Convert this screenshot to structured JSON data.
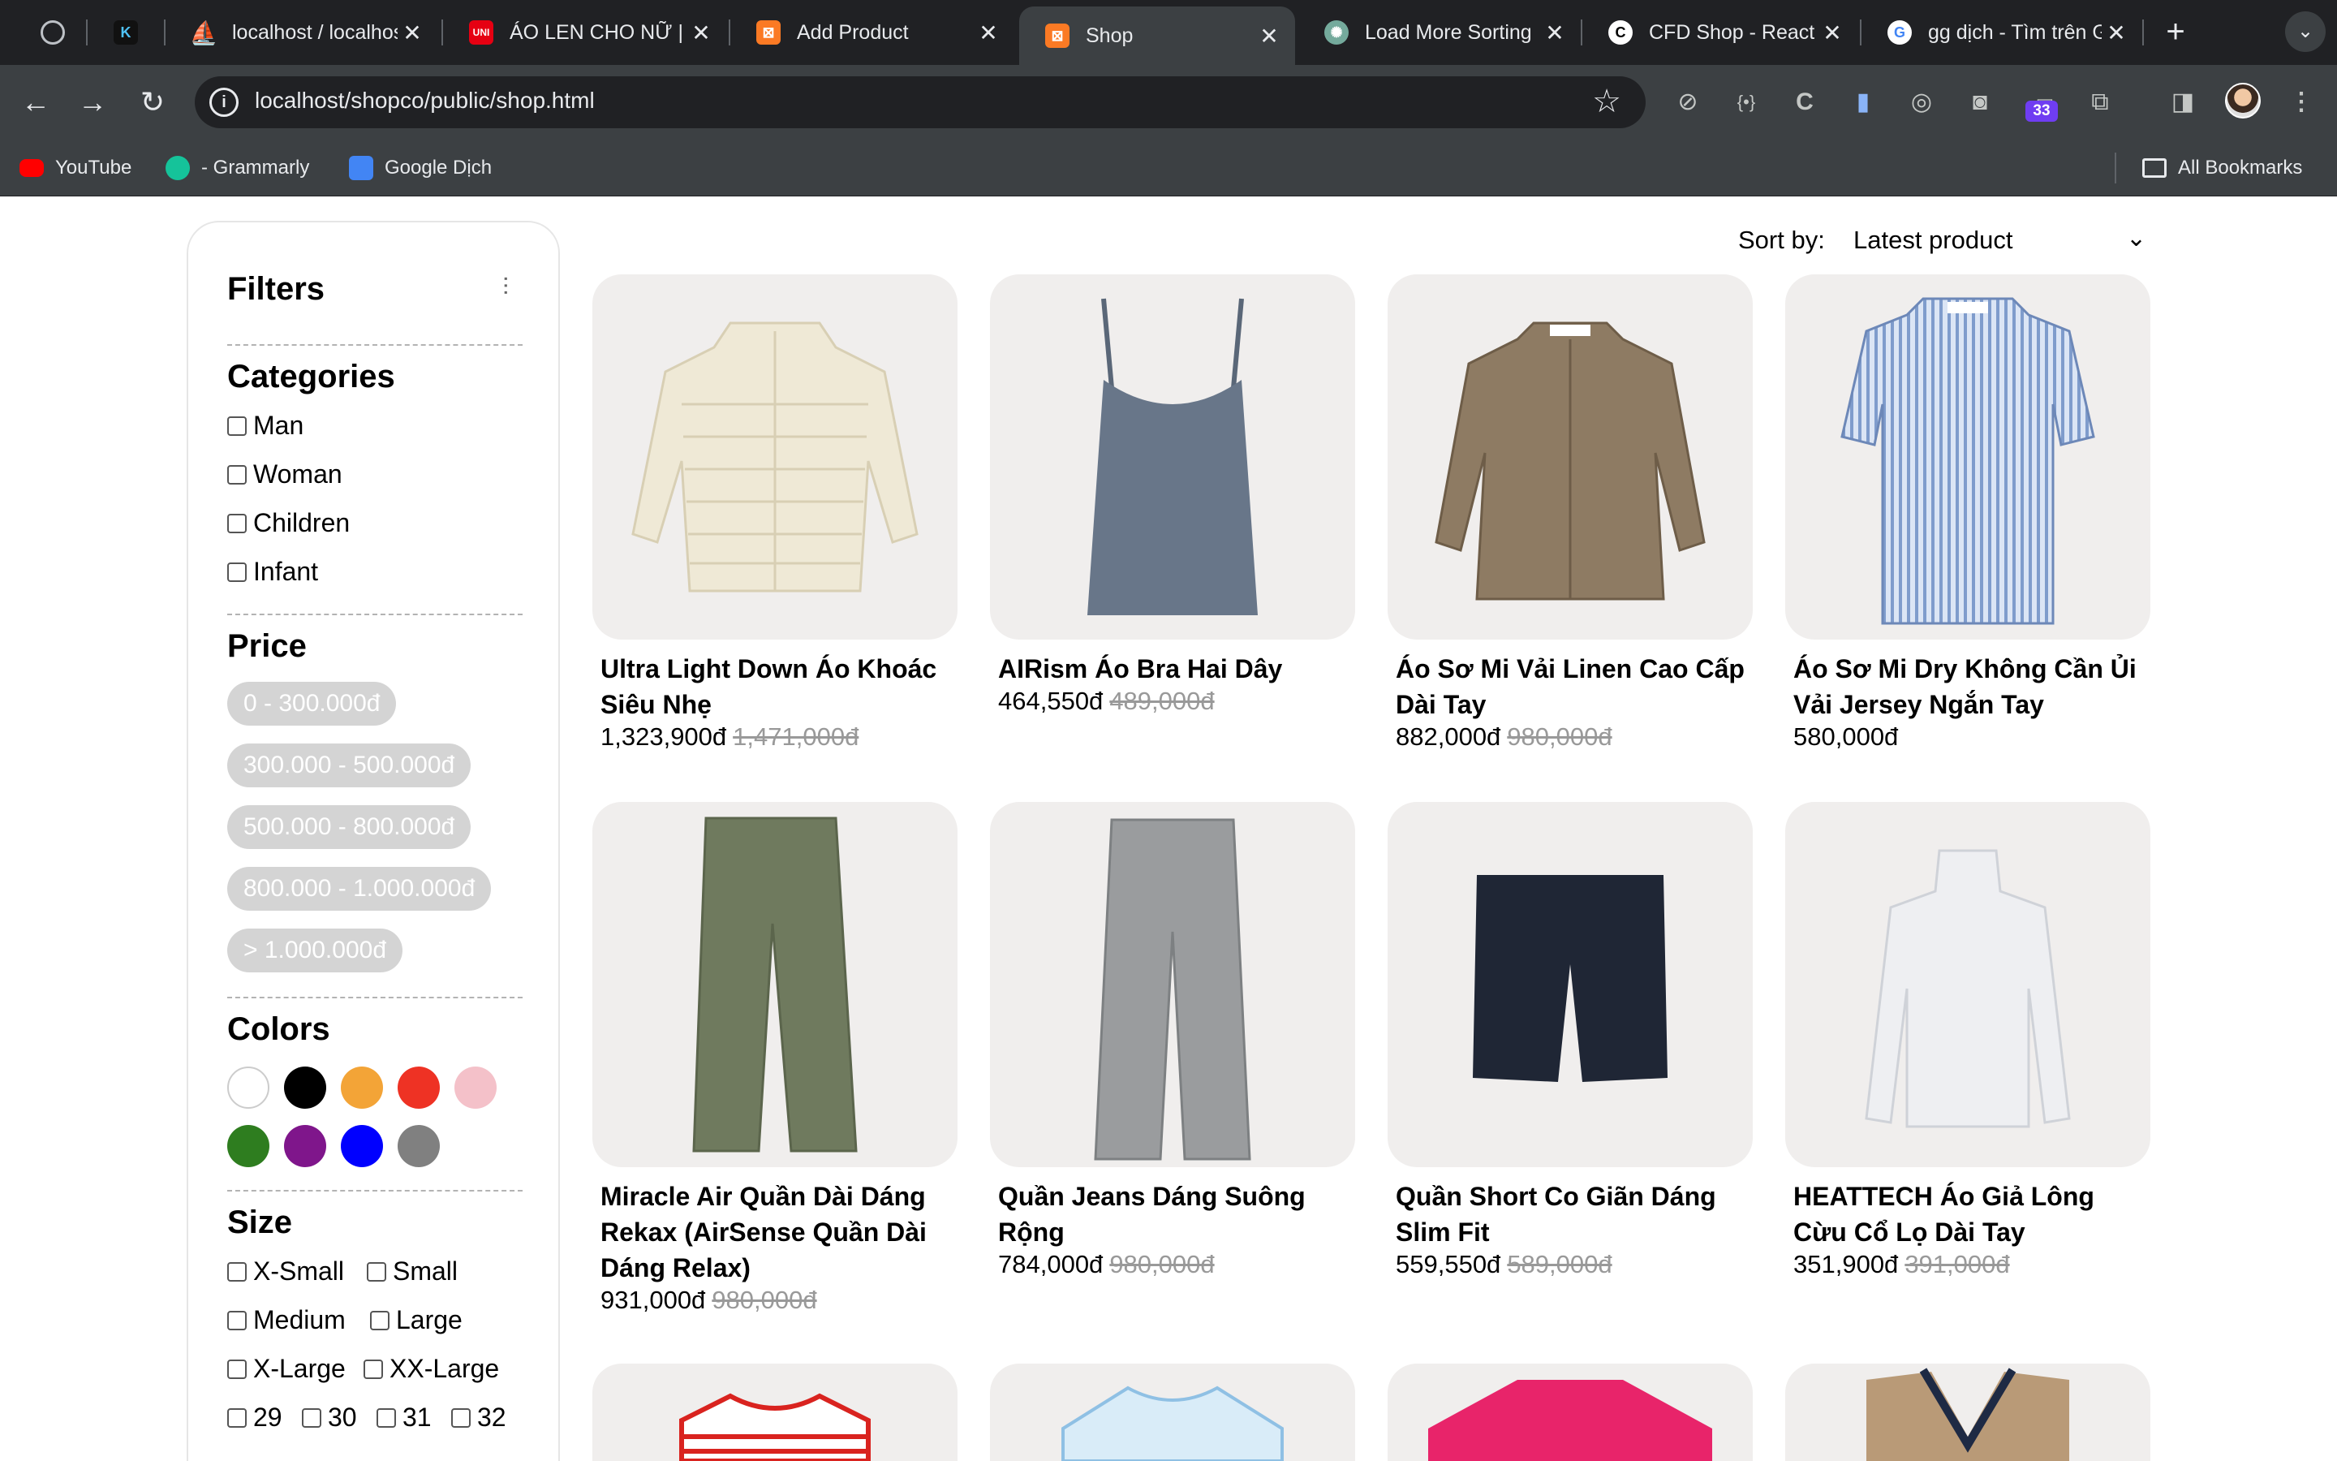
{
  "browser": {
    "tabs": [
      {
        "title": "",
        "icon": "globe-icon"
      },
      {
        "title": "",
        "icon": "k-app-icon"
      },
      {
        "title": "localhost / localhost",
        "icon": "phpmyadmin-icon"
      },
      {
        "title": "ÁO LEN CHO NỮ | UNIQLO",
        "icon": "uniqlo-icon"
      },
      {
        "title": "Add Product",
        "icon": "xampp-icon"
      },
      {
        "title": "Shop",
        "icon": "xampp-icon",
        "active": true
      },
      {
        "title": "Load More Sorting",
        "icon": "chatgpt-icon"
      },
      {
        "title": "CFD Shop - React",
        "icon": "cfd-icon"
      },
      {
        "title": "gg dịch - Tìm trên Google",
        "icon": "google-icon"
      }
    ],
    "url": "localhost/shopco/public/shop.html",
    "extension_badge": "33",
    "bookmarks": [
      {
        "label": "YouTube",
        "icon": "youtube-icon"
      },
      {
        "label": "- Grammarly",
        "icon": "grammarly-icon"
      },
      {
        "label": "Google Dịch",
        "icon": "google-translate-icon"
      }
    ],
    "all_bookmarks": "All Bookmarks"
  },
  "filters": {
    "title": "Filters",
    "categories": {
      "heading": "Categories",
      "items": [
        "Man",
        "Woman",
        "Children",
        "Infant"
      ]
    },
    "price": {
      "heading": "Price",
      "ranges": [
        "0 - 300.000đ",
        "300.000 - 500.000đ",
        "500.000 - 800.000đ",
        "800.000 - 1.000.000đ",
        "> 1.000.000đ"
      ]
    },
    "colors": {
      "heading": "Colors",
      "swatches": [
        "#ffffff",
        "#000000",
        "#f3a437",
        "#ee3224",
        "#f4c1c9",
        "#2e7d1f",
        "#7f168b",
        "#0000ff",
        "#808080"
      ]
    },
    "size": {
      "heading": "Size",
      "items": [
        "X-Small",
        "Small",
        "Medium",
        "Large",
        "X-Large",
        "XX-Large",
        "29",
        "30",
        "31",
        "32"
      ]
    }
  },
  "sort": {
    "label": "Sort by:",
    "value": "Latest product"
  },
  "products": [
    {
      "name": "Ultra Light Down Áo Khoác Siêu Nhẹ",
      "price": "1,323,900đ",
      "old_price": "1,471,000đ",
      "image": "cream-puffer-jacket"
    },
    {
      "name": "AIRism Áo Bra Hai Dây",
      "price": "464,550đ",
      "old_price": "489,000đ",
      "image": "grey-camisole"
    },
    {
      "name": "Áo Sơ Mi Vải Linen Cao Cấp Dài Tay",
      "price": "882,000đ",
      "old_price": "980,000đ",
      "image": "brown-linen-shirt"
    },
    {
      "name": "Áo Sơ Mi Dry Không Cần Ủi Vải Jersey Ngắn Tay",
      "price": "580,000đ",
      "old_price": "",
      "image": "blue-striped-shirt"
    },
    {
      "name": "Miracle Air Quần Dài Dáng Rekax (AirSense Quần Dài Dáng Relax)",
      "price": "931,000đ",
      "old_price": "980,000đ",
      "image": "olive-trousers"
    },
    {
      "name": "Quần Jeans Dáng Suông Rộng",
      "price": "784,000đ",
      "old_price": "980,000đ",
      "image": "grey-jeans"
    },
    {
      "name": "Quần Short Co Giãn Dáng Slim Fit",
      "price": "559,550đ",
      "old_price": "589,000đ",
      "image": "navy-shorts"
    },
    {
      "name": "HEATTECH Áo Giả Lông Cừu Cổ Lọ Dài Tay",
      "price": "351,900đ",
      "old_price": "391,000đ",
      "image": "white-turtleneck"
    }
  ]
}
